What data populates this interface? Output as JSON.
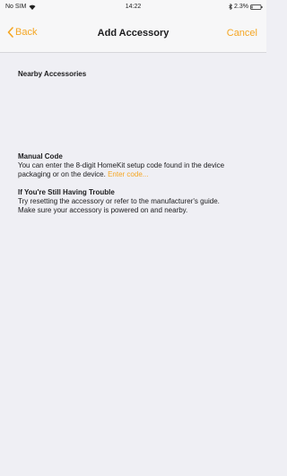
{
  "status_bar": {
    "carrier": "No SIM",
    "time": "14:22",
    "battery_text": "2.3%"
  },
  "nav": {
    "back_label": "Back",
    "title": "Add Accessory",
    "cancel_label": "Cancel"
  },
  "sections": {
    "nearby_heading": "Nearby Accessories",
    "manual_heading": "Manual Code",
    "manual_text": "You can enter the 8-digit HomeKit setup code found in the device packaging or on the device.",
    "manual_link": "Enter code...",
    "trouble_heading": "If You're Still Having Trouble",
    "trouble_line1": "Try resetting the accessory or refer to the manufacturer's guide.",
    "trouble_line2": "Make sure your accessory is powered on and nearby."
  },
  "colors": {
    "accent": "#f5a623",
    "background": "#efeff4"
  }
}
